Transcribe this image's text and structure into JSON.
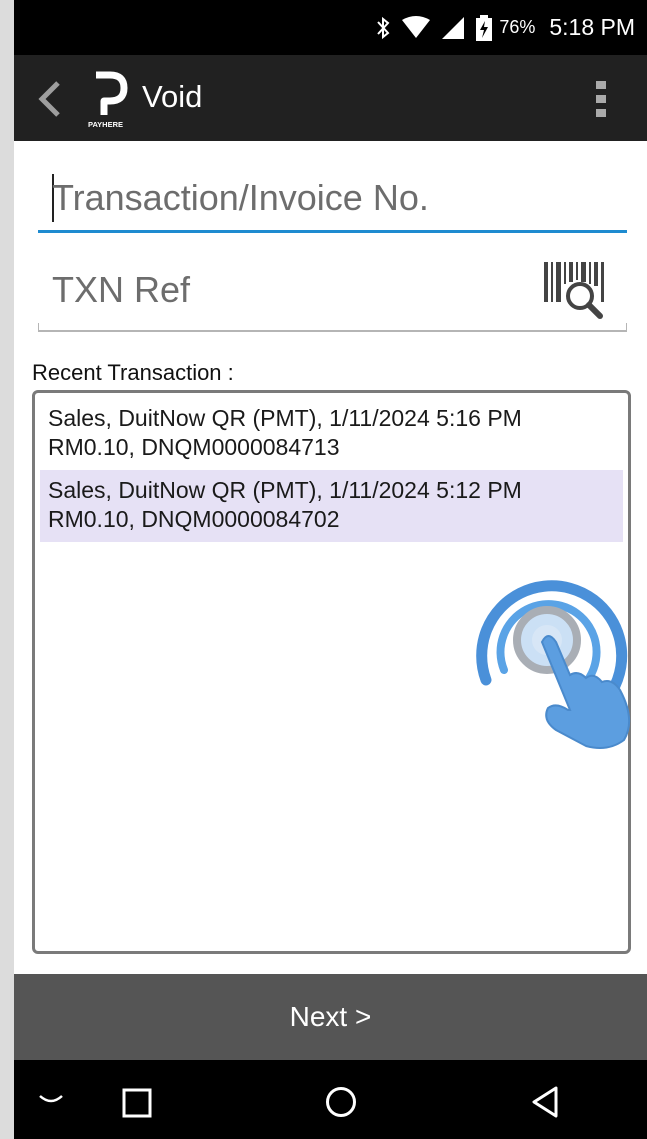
{
  "status_bar": {
    "icons": [
      "bluetooth-icon",
      "wifi-icon",
      "signal-icon",
      "battery-charging-icon"
    ],
    "battery": "76%",
    "time": "5:18 PM"
  },
  "app_bar": {
    "title": "Void",
    "logo_text": "PAYHERE"
  },
  "form": {
    "txn_placeholder": "Transaction/Invoice No.",
    "txn_value": "",
    "ref_placeholder": "TXN Ref",
    "ref_value": ""
  },
  "recent": {
    "label": "Recent Transaction :",
    "items": [
      {
        "line1": "Sales, DuitNow QR (PMT), 1/11/2024 5:16 PM",
        "line2": "RM0.10, DNQM0000084713",
        "selected": false
      },
      {
        "line1": "Sales, DuitNow QR (PMT), 1/11/2024 5:12 PM",
        "line2": "RM0.10, DNQM0000084702",
        "selected": true
      }
    ]
  },
  "footer": {
    "next_label": "Next >"
  },
  "colors": {
    "accent": "#1e8bd0",
    "app_bar": "#212121",
    "next_bar": "#555555",
    "selected_row": "#e6e1f5"
  }
}
